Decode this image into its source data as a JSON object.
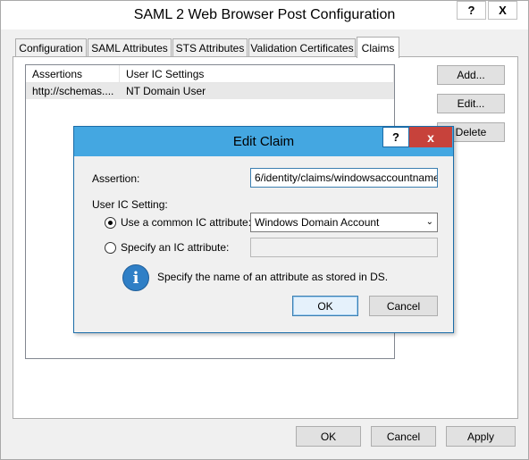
{
  "window": {
    "title": "SAML 2 Web Browser Post Configuration",
    "help_glyph": "?",
    "close_glyph": "X"
  },
  "tabs": [
    {
      "label": "Configuration"
    },
    {
      "label": "SAML Attributes"
    },
    {
      "label": "STS Attributes"
    },
    {
      "label": "Validation Certificates"
    },
    {
      "label": "Claims",
      "active": true
    }
  ],
  "claims_list": {
    "columns": [
      "Assertions",
      "User IC Settings"
    ],
    "rows": [
      {
        "assertion": "http://schemas....",
        "setting": "NT Domain User"
      }
    ]
  },
  "side_buttons": {
    "add": "Add...",
    "edit": "Edit...",
    "delete": "Delete"
  },
  "dialog": {
    "title": "Edit Claim",
    "help_glyph": "?",
    "close_glyph": "x",
    "assertion_label": "Assertion:",
    "assertion_value": "6/identity/claims/windowsaccountname",
    "user_ic_label": "User IC Setting:",
    "radio_common_label": "Use a common IC attribute:",
    "radio_common_selected": true,
    "common_select_value": "Windows Domain Account",
    "radio_specify_label": "Specify an IC attribute:",
    "specify_value": "",
    "info_text": "Specify the name of an attribute as stored in DS.",
    "ok": "OK",
    "cancel": "Cancel"
  },
  "footer": {
    "ok": "OK",
    "cancel": "Cancel",
    "apply": "Apply"
  }
}
